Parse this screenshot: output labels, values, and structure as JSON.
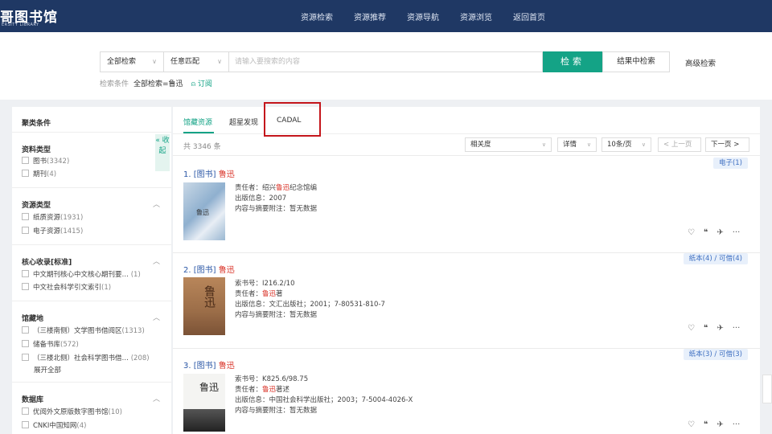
{
  "header": {
    "logo_text": "哥图书馆",
    "logo_sub": "ERSITY LIBRARY",
    "nav": [
      "资源检索",
      "资源推荐",
      "资源导航",
      "资源浏览",
      "返回首页"
    ]
  },
  "search": {
    "scope": "全部检索",
    "match": "任意匹配",
    "placeholder": "请输入要搜索的内容",
    "search_btn": "检索",
    "within_btn": "结果中检索",
    "advanced": "高级检索",
    "cond_label": "检索条件",
    "cond_value": "全部检索=鲁迅",
    "subscribe": "订阅"
  },
  "sidebar": {
    "header": "聚类条件",
    "collapse": "« 收起",
    "groups": [
      {
        "title": "资料类型",
        "items": [
          {
            "label": "图书",
            "count": "(3342)"
          },
          {
            "label": "期刊",
            "count": "(4)"
          }
        ]
      },
      {
        "title": "资源类型",
        "items": [
          {
            "label": "纸质资源",
            "count": "(1931)"
          },
          {
            "label": "电子资源",
            "count": "(1415)"
          }
        ]
      },
      {
        "title": "核心收录[标准]",
        "items": [
          {
            "label": "中文期刊核心中文核心期刊要…",
            "count": "(1)"
          },
          {
            "label": "中文社会科学引文索引",
            "count": "(1)"
          }
        ]
      },
      {
        "title": "馆藏地",
        "items": [
          {
            "label": "（三楼南侧）文学图书借阅区",
            "count": "(1313)"
          },
          {
            "label": "储备书库",
            "count": "(572)"
          },
          {
            "label": "（三楼北侧）社会科学图书借…",
            "count": "(208)"
          }
        ],
        "more": "展开全部"
      },
      {
        "title": "数据库",
        "items": [
          {
            "label": "优阅外文原版数字图书馆",
            "count": "(10)"
          },
          {
            "label": "CNKI中国知网",
            "count": "(4)"
          }
        ]
      }
    ]
  },
  "main": {
    "tabs": [
      "馆藏资源",
      "超星发现",
      "CADAL"
    ],
    "total": "共 3346 条",
    "sort": "相关度",
    "detail": "详情",
    "per_page": "10条/页",
    "prev": "< 上一页",
    "next": "下一页 >",
    "records": [
      {
        "title_prefix": "1. [图书] ",
        "title_hl": "鲁迅",
        "cover_text": "鲁迅",
        "tag": "电子(1)",
        "lines": [
          {
            "pre": "责任者：绍兴",
            "hl": "鲁迅",
            "post": "纪念馆编"
          },
          {
            "pre": "出版信息：2007",
            "hl": "",
            "post": ""
          },
          {
            "pre": "内容与摘要附注：暂无数据",
            "hl": "",
            "post": ""
          }
        ]
      },
      {
        "title_prefix": "2. [图书] ",
        "title_hl": "鲁迅",
        "cover_text": "鲁迅",
        "tag": "纸本(4) / 可借(4)",
        "lines": [
          {
            "pre": "索书号：I216.2/10",
            "hl": "",
            "post": ""
          },
          {
            "pre": "责任者：",
            "hl": "鲁迅",
            "post": "著"
          },
          {
            "pre": "出版信息：文汇出版社；2001；7-80531-810-7",
            "hl": "",
            "post": ""
          },
          {
            "pre": "内容与摘要附注：暂无数据",
            "hl": "",
            "post": ""
          }
        ]
      },
      {
        "title_prefix": "3. [图书] ",
        "title_hl": "鲁迅",
        "cover_text": "鲁迅",
        "tag": "纸本(3) / 可借(3)",
        "lines": [
          {
            "pre": "索书号：K825.6/98.75",
            "hl": "",
            "post": ""
          },
          {
            "pre": "责任者：",
            "hl": "鲁迅",
            "post": "著述"
          },
          {
            "pre": "出版信息：中国社会科学出版社；2003；7-5004-4026-X",
            "hl": "",
            "post": ""
          },
          {
            "pre": "内容与摘要附注：暂无数据",
            "hl": "",
            "post": ""
          }
        ]
      }
    ],
    "actions": {
      "favorite": "♡",
      "cite": "❝",
      "share": "✈",
      "more": "···"
    }
  }
}
